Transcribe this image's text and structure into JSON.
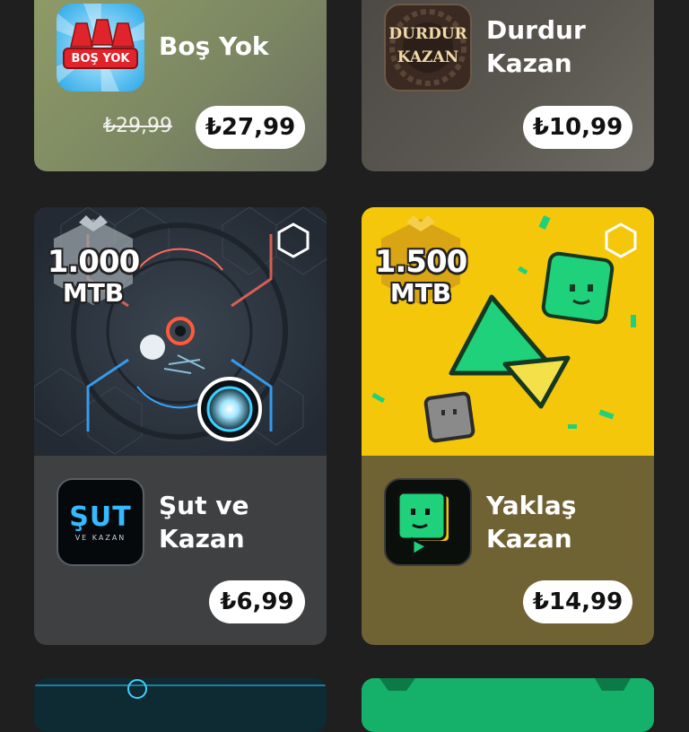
{
  "cards": [
    {
      "title": "Boş Yok",
      "icon_text": "BOŞ YOK",
      "old_price": "₺29,99",
      "price": "₺27,99"
    },
    {
      "title_line1": "Durdur",
      "title_line2": "Kazan",
      "icon_text_line1": "DURDUR",
      "icon_text_line2": "KAZAN",
      "price": "₺10,99"
    },
    {
      "title_line1": "Şut ve",
      "title_line2": "Kazan",
      "icon_text_line1": "ŞUT",
      "icon_text_line2": "VE KAZAN",
      "reward_amount": "1.000",
      "reward_unit": "MTB",
      "price": "₺6,99"
    },
    {
      "title_line1": "Yaklaş",
      "title_line2": "Kazan",
      "reward_amount": "1.500",
      "reward_unit": "MTB",
      "price": "₺14,99"
    }
  ],
  "colors": {
    "background": "#1f1f1f",
    "reward_silver": "#9aa3aa",
    "reward_gold": "#d9a514",
    "yaklas_banner": "#f4c70b",
    "yaklas_green": "#1fd17a"
  }
}
